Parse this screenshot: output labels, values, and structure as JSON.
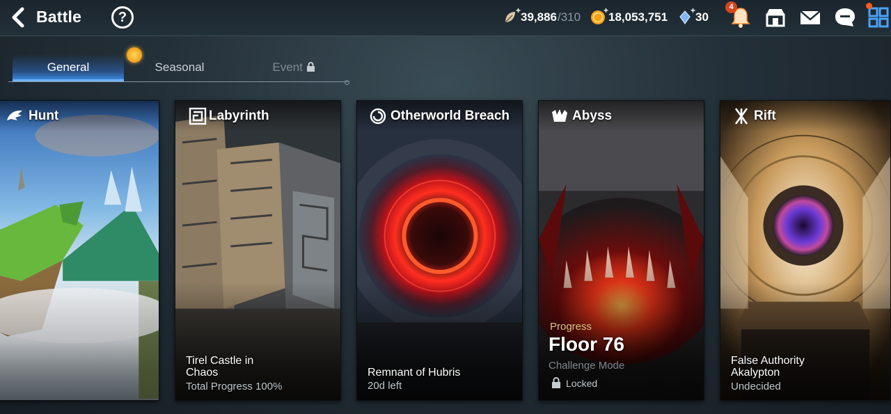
{
  "header": {
    "title": "Battle",
    "help_icon": "question-circle-icon",
    "stamina": {
      "value": "39,886",
      "max": "/310",
      "icon": "stamina-leaf-icon"
    },
    "gold": {
      "value": "18,053,751",
      "icon": "gold-coin-icon"
    },
    "crystal": {
      "value": "30",
      "icon": "crystal-icon"
    },
    "notification_count": "4",
    "icons": [
      "bell-icon",
      "shop-icon",
      "mail-icon",
      "chat-icon",
      "menu-grid-icon"
    ]
  },
  "tabs": [
    {
      "label": "General",
      "active": true
    },
    {
      "label": "Seasonal",
      "active": false
    },
    {
      "label": "Event",
      "locked": true
    }
  ],
  "cards": [
    {
      "name": "Hunt",
      "icon": "hunt-dragon-icon",
      "line1": "",
      "line2": ""
    },
    {
      "name": "Labyrinth",
      "icon": "labyrinth-maze-icon",
      "line1": "Tirel Castle in\nChaos",
      "line2": "Total Progress 100%"
    },
    {
      "name": "Otherworld Breach",
      "icon": "portal-swirl-icon",
      "line1": "Remnant of Hubris",
      "line2": "20d left"
    },
    {
      "name": "Abyss",
      "icon": "abyss-claw-icon",
      "progress_label": "Progress",
      "floor": "Floor 76",
      "mode": "Challenge Mode",
      "status": "Locked"
    },
    {
      "name": "Rift",
      "icon": "rift-crack-icon",
      "line1": "False Authority\nAkalypton",
      "line2": "Undecided"
    }
  ],
  "colors": {
    "accent": "#3a86d9",
    "badge": "#d8451d",
    "gold": "#f3a11b"
  }
}
